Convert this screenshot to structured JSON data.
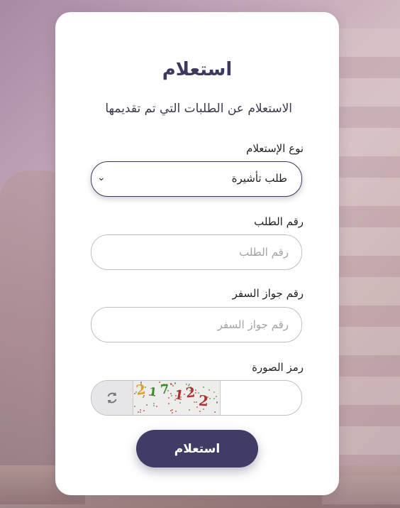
{
  "title": "استعلام",
  "subtitle": "الاستعلام عن الطلبات التي تم تقديمها",
  "inquiry_type": {
    "label": "نوع الإستعلام",
    "selected": "طلب تأشيرة"
  },
  "request_number": {
    "label": "رقم الطلب",
    "placeholder": "رقم الطلب"
  },
  "passport_number": {
    "label": "رقم جواز السفر",
    "placeholder": "رقم جواز السفر"
  },
  "captcha": {
    "label": "رمز الصورة",
    "digits": [
      {
        "char": "2",
        "color": "#e0a020"
      },
      {
        "char": "1",
        "color": "#3a8a2a"
      },
      {
        "char": "7",
        "color": "#3a8a2a"
      },
      {
        "char": "1",
        "color": "#b03030"
      },
      {
        "char": "2",
        "color": "#b03030"
      },
      {
        "char": "2",
        "color": "#b03030"
      }
    ],
    "refresh_icon": "refresh-icon"
  },
  "submit": {
    "label": "استعلام"
  },
  "colors": {
    "primary": "#3f3d65"
  }
}
